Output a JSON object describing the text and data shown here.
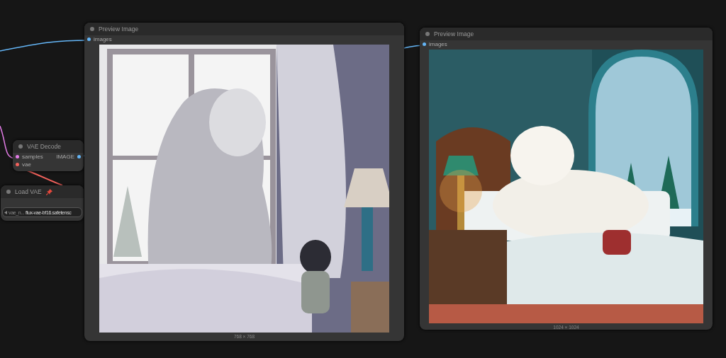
{
  "nodes": [
    {
      "kind": "decode",
      "title": "VAE Decode",
      "inputs": [
        {
          "label": "samples",
          "color": "#e27ce6"
        },
        {
          "label": "vae",
          "color": "#f2625c"
        }
      ],
      "outputs": [
        {
          "label": "IMAGE",
          "color": "#64b5f6"
        }
      ]
    },
    {
      "kind": "loader",
      "title": "Load VAE",
      "pinned": true,
      "widget": {
        "name": "vae_n...",
        "value": "flux-vae-bf16.safetensc"
      }
    },
    {
      "kind": "preview",
      "title": "Preview Image",
      "inputs": [
        {
          "label": "images",
          "color": "#64b5f6"
        }
      ],
      "image": {
        "kind": "picture"
      },
      "image_size": "768 × 768"
    },
    {
      "kind": "preview",
      "title": "Preview Image",
      "inputs": [
        {
          "label": "images",
          "color": "#64b5f6"
        }
      ],
      "image": {
        "kind": "picture"
      },
      "image_size": "1024 × 1024"
    }
  ]
}
